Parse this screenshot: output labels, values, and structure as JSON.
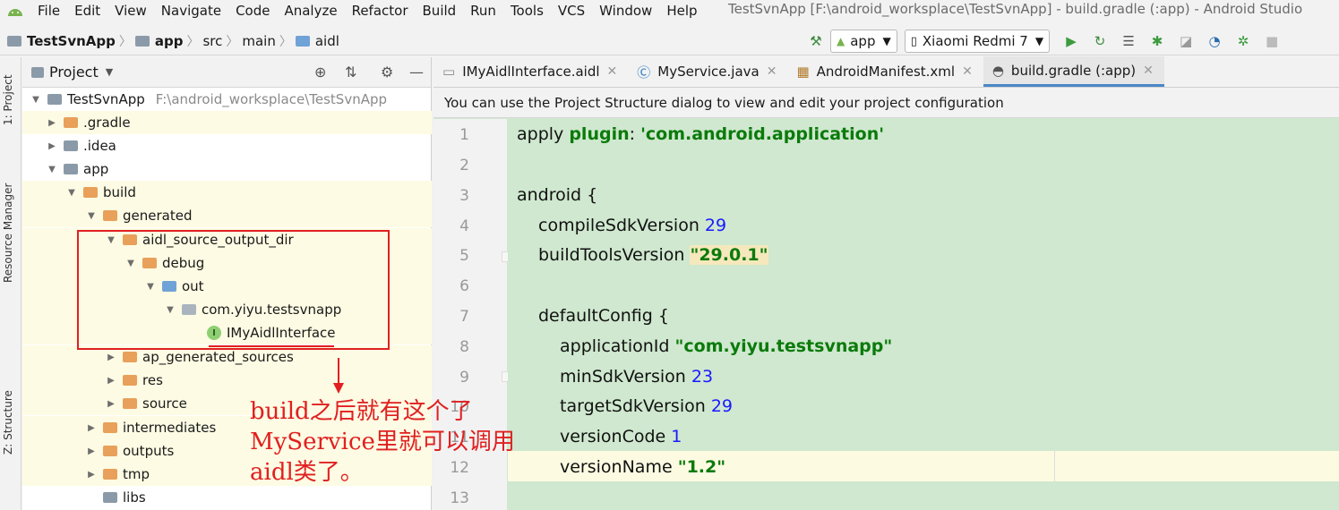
{
  "menubar": {
    "items": [
      "File",
      "Edit",
      "View",
      "Navigate",
      "Code",
      "Analyze",
      "Refactor",
      "Build",
      "Run",
      "Tools",
      "VCS",
      "Window",
      "Help"
    ],
    "window_title": "TestSvnApp [F:\\android_worksplace\\TestSvnApp] - build.gradle (:app) - Android Studio"
  },
  "breadcrumb": {
    "items": [
      "TestSvnApp",
      "app",
      "src",
      "main",
      "aidl"
    ]
  },
  "toolbar": {
    "config_combo": "app",
    "device_combo": "Xiaomi Redmi 7"
  },
  "left_strip": {
    "project_tab": "1: Project",
    "resource_tab": "Resource Manager",
    "structure_tab": "Z: Structure"
  },
  "project_panel": {
    "title": "Project",
    "root_name": "TestSvnApp",
    "root_path": "F:\\android_worksplace\\TestSvnApp",
    "nodes": [
      ".gradle",
      ".idea",
      "app",
      "build",
      "generated",
      "aidl_source_output_dir",
      "debug",
      "out",
      "com.yiyu.testsvnapp",
      "IMyAidlInterface",
      "ap_generated_sources",
      "res",
      "source",
      "intermediates",
      "outputs",
      "tmp",
      "libs"
    ]
  },
  "editor": {
    "tabs": [
      "IMyAidlInterface.aidl",
      "MyService.java",
      "AndroidManifest.xml",
      "build.gradle (:app)"
    ],
    "banner": "You can use the Project Structure dialog to view and edit your project configuration",
    "line_numbers": [
      "1",
      "2",
      "3",
      "4",
      "5",
      "6",
      "7",
      "8",
      "9",
      "10",
      "11",
      "12",
      "13"
    ],
    "code": {
      "l1_a": "apply ",
      "l1_b": "plugin",
      "l1_c": ": ",
      "l1_d": "'com.android.application'",
      "l3": "android {",
      "l4_a": "compileSdkVersion ",
      "l4_b": "29",
      "l5_a": "buildToolsVersion ",
      "l5_b": "\"29.0.1\"",
      "l7": "defaultConfig {",
      "l8_a": "applicationId ",
      "l8_b": "\"com.yiyu.testsvnapp\"",
      "l9_a": "minSdkVersion ",
      "l9_b": "23",
      "l10_a": "targetSdkVersion ",
      "l10_b": "29",
      "l11_a": "versionCode ",
      "l11_b": "1",
      "l12_a": "versionName ",
      "l12_b": "\"1.2\""
    }
  },
  "annotation": {
    "line1": "build之后就有这个了",
    "line2": "MyService里就可以调用",
    "line3": "aidl类了。"
  },
  "colors": {
    "folder_orange": "#e8a05a",
    "folder_gray": "#8b9aa8",
    "folder_blue": "#6fa2d6",
    "editor_bg": "#cfe8cf",
    "annotation_red": "#e02020",
    "keyword_green": "#0b7a0b",
    "number_blue": "#1a1aff"
  }
}
